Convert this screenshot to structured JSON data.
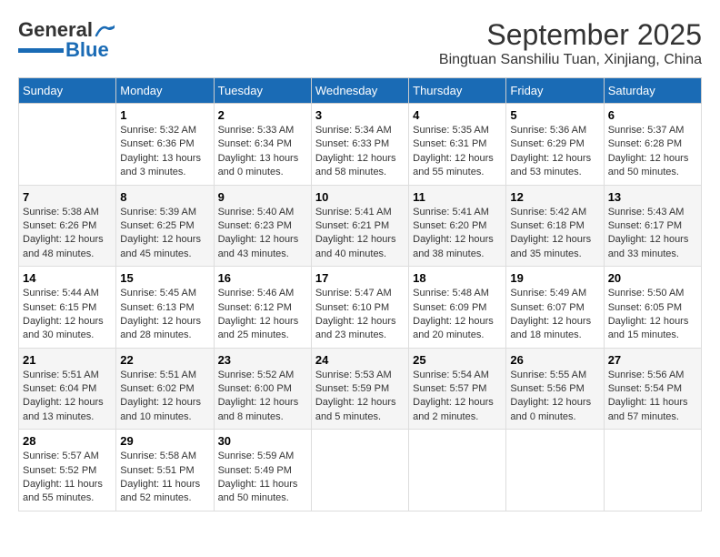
{
  "logo": {
    "line1": "General",
    "line2": "Blue"
  },
  "title": "September 2025",
  "subtitle": "Bingtuan Sanshiliu Tuan, Xinjiang, China",
  "days_of_week": [
    "Sunday",
    "Monday",
    "Tuesday",
    "Wednesday",
    "Thursday",
    "Friday",
    "Saturday"
  ],
  "weeks": [
    [
      {
        "num": "",
        "detail": ""
      },
      {
        "num": "1",
        "detail": "Sunrise: 5:32 AM\nSunset: 6:36 PM\nDaylight: 13 hours\nand 3 minutes."
      },
      {
        "num": "2",
        "detail": "Sunrise: 5:33 AM\nSunset: 6:34 PM\nDaylight: 13 hours\nand 0 minutes."
      },
      {
        "num": "3",
        "detail": "Sunrise: 5:34 AM\nSunset: 6:33 PM\nDaylight: 12 hours\nand 58 minutes."
      },
      {
        "num": "4",
        "detail": "Sunrise: 5:35 AM\nSunset: 6:31 PM\nDaylight: 12 hours\nand 55 minutes."
      },
      {
        "num": "5",
        "detail": "Sunrise: 5:36 AM\nSunset: 6:29 PM\nDaylight: 12 hours\nand 53 minutes."
      },
      {
        "num": "6",
        "detail": "Sunrise: 5:37 AM\nSunset: 6:28 PM\nDaylight: 12 hours\nand 50 minutes."
      }
    ],
    [
      {
        "num": "7",
        "detail": "Sunrise: 5:38 AM\nSunset: 6:26 PM\nDaylight: 12 hours\nand 48 minutes."
      },
      {
        "num": "8",
        "detail": "Sunrise: 5:39 AM\nSunset: 6:25 PM\nDaylight: 12 hours\nand 45 minutes."
      },
      {
        "num": "9",
        "detail": "Sunrise: 5:40 AM\nSunset: 6:23 PM\nDaylight: 12 hours\nand 43 minutes."
      },
      {
        "num": "10",
        "detail": "Sunrise: 5:41 AM\nSunset: 6:21 PM\nDaylight: 12 hours\nand 40 minutes."
      },
      {
        "num": "11",
        "detail": "Sunrise: 5:41 AM\nSunset: 6:20 PM\nDaylight: 12 hours\nand 38 minutes."
      },
      {
        "num": "12",
        "detail": "Sunrise: 5:42 AM\nSunset: 6:18 PM\nDaylight: 12 hours\nand 35 minutes."
      },
      {
        "num": "13",
        "detail": "Sunrise: 5:43 AM\nSunset: 6:17 PM\nDaylight: 12 hours\nand 33 minutes."
      }
    ],
    [
      {
        "num": "14",
        "detail": "Sunrise: 5:44 AM\nSunset: 6:15 PM\nDaylight: 12 hours\nand 30 minutes."
      },
      {
        "num": "15",
        "detail": "Sunrise: 5:45 AM\nSunset: 6:13 PM\nDaylight: 12 hours\nand 28 minutes."
      },
      {
        "num": "16",
        "detail": "Sunrise: 5:46 AM\nSunset: 6:12 PM\nDaylight: 12 hours\nand 25 minutes."
      },
      {
        "num": "17",
        "detail": "Sunrise: 5:47 AM\nSunset: 6:10 PM\nDaylight: 12 hours\nand 23 minutes."
      },
      {
        "num": "18",
        "detail": "Sunrise: 5:48 AM\nSunset: 6:09 PM\nDaylight: 12 hours\nand 20 minutes."
      },
      {
        "num": "19",
        "detail": "Sunrise: 5:49 AM\nSunset: 6:07 PM\nDaylight: 12 hours\nand 18 minutes."
      },
      {
        "num": "20",
        "detail": "Sunrise: 5:50 AM\nSunset: 6:05 PM\nDaylight: 12 hours\nand 15 minutes."
      }
    ],
    [
      {
        "num": "21",
        "detail": "Sunrise: 5:51 AM\nSunset: 6:04 PM\nDaylight: 12 hours\nand 13 minutes."
      },
      {
        "num": "22",
        "detail": "Sunrise: 5:51 AM\nSunset: 6:02 PM\nDaylight: 12 hours\nand 10 minutes."
      },
      {
        "num": "23",
        "detail": "Sunrise: 5:52 AM\nSunset: 6:00 PM\nDaylight: 12 hours\nand 8 minutes."
      },
      {
        "num": "24",
        "detail": "Sunrise: 5:53 AM\nSunset: 5:59 PM\nDaylight: 12 hours\nand 5 minutes."
      },
      {
        "num": "25",
        "detail": "Sunrise: 5:54 AM\nSunset: 5:57 PM\nDaylight: 12 hours\nand 2 minutes."
      },
      {
        "num": "26",
        "detail": "Sunrise: 5:55 AM\nSunset: 5:56 PM\nDaylight: 12 hours\nand 0 minutes."
      },
      {
        "num": "27",
        "detail": "Sunrise: 5:56 AM\nSunset: 5:54 PM\nDaylight: 11 hours\nand 57 minutes."
      }
    ],
    [
      {
        "num": "28",
        "detail": "Sunrise: 5:57 AM\nSunset: 5:52 PM\nDaylight: 11 hours\nand 55 minutes."
      },
      {
        "num": "29",
        "detail": "Sunrise: 5:58 AM\nSunset: 5:51 PM\nDaylight: 11 hours\nand 52 minutes."
      },
      {
        "num": "30",
        "detail": "Sunrise: 5:59 AM\nSunset: 5:49 PM\nDaylight: 11 hours\nand 50 minutes."
      },
      {
        "num": "",
        "detail": ""
      },
      {
        "num": "",
        "detail": ""
      },
      {
        "num": "",
        "detail": ""
      },
      {
        "num": "",
        "detail": ""
      }
    ]
  ]
}
